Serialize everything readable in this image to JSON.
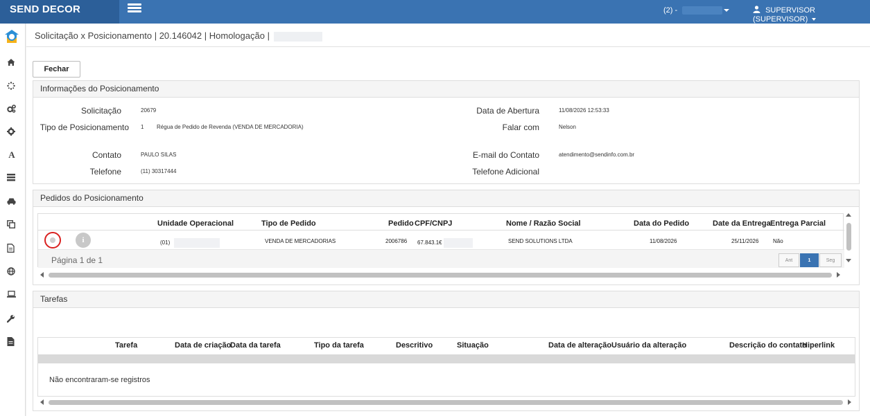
{
  "app": {
    "brand": "SEND DECOR",
    "connection_label": "(2) -",
    "user_label": "SUPERVISOR (SUPERVISOR)"
  },
  "breadcrumb": "Solicitação x Posicionamento | 20.146042 | Homologação |",
  "actions": {
    "close_label": "Fechar"
  },
  "info_panel": {
    "title": "Informações do Posicionamento",
    "solicitacao_label": "Solicitação",
    "solicitacao_value": "20679",
    "tipo_label": "Tipo de Posicionamento",
    "tipo_code": "1",
    "tipo_value": "Régua de Pedido de Revenda (VENDA DE MERCADORIA)",
    "contato_label": "Contato",
    "contato_value": "PAULO SILAS",
    "telefone_label": "Telefone",
    "telefone_value": "(11) 30317444",
    "data_abertura_label": "Data de Abertura",
    "data_abertura_value": "11/08/2026 12:53:33",
    "falar_com_label": "Falar com",
    "falar_com_value": "Nelson",
    "email_label": "E-mail do Contato",
    "email_value": "atendimento@sendinfo.com.br",
    "telefone_adicional_label": "Telefone Adicional"
  },
  "orders_panel": {
    "title": "Pedidos do Posicionamento",
    "columns": [
      "Unidade Operacional",
      "Tipo de Pedido",
      "Pedido",
      "CPF/CNPJ",
      "Nome / Razão Social",
      "Data do Pedido",
      "Date da Entrega",
      "Entrega Parcial"
    ],
    "rows": [
      {
        "unidade": "(01)",
        "tipo_pedido": "VENDA DE MERCADORIAS",
        "pedido": "2006786",
        "cpf_cnpj": "67.843.1€",
        "nome": "SEND SOLUTIONS LTDA",
        "data_pedido": "11/08/2026",
        "data_entrega": "25/11/2026",
        "entrega_parcial": "Não"
      }
    ],
    "pagination": {
      "text": "Página 1 de 1",
      "prev": "Ant",
      "current": "1",
      "next": "Seg"
    }
  },
  "tasks_panel": {
    "title": "Tarefas",
    "columns": [
      "Tarefa",
      "Data de criação",
      "Data da tarefa",
      "Tipo da tarefa",
      "Descritivo",
      "Situação",
      "Data de alteração",
      "Usuário da alteração",
      "Descrição do contato",
      "Hiperlink"
    ],
    "empty_message": "Não encontraram-se registros"
  },
  "colors": {
    "topbar": "#3a73b2",
    "brand_bg": "#2c5f99",
    "highlight_ring": "#d9201f"
  },
  "icons": {
    "sidebar": [
      "home-icon",
      "spinner-icon",
      "cogs-icon",
      "gear-icon",
      "font-icon",
      "list-icon",
      "car-icon",
      "copy-icon",
      "document-icon",
      "globe-icon",
      "laptop-icon",
      "wrench-icon",
      "file-icon"
    ]
  }
}
